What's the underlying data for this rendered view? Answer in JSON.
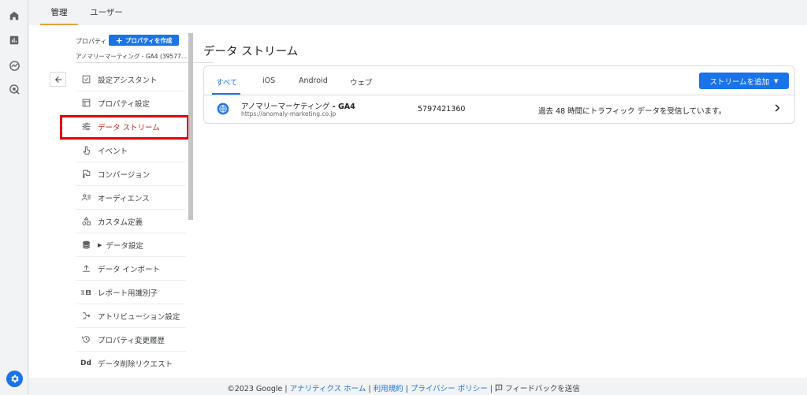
{
  "topbar": {
    "tabs": [
      {
        "label": "管理",
        "active": true
      },
      {
        "label": "ユーザー",
        "active": false
      }
    ]
  },
  "rail": {
    "icons": [
      "home-icon",
      "reports-icon",
      "explore-icon",
      "advertising-icon"
    ],
    "settings_icon": "gear-icon"
  },
  "property": {
    "label": "プロパティ",
    "create_button": "プロパティを作成",
    "name": "アノマリーマーティング - GA4 (39577…"
  },
  "menu": {
    "items": [
      {
        "label": "設定アシスタント",
        "icon": "checklist-icon"
      },
      {
        "label": "プロパティ設定",
        "icon": "property-settings-icon"
      },
      {
        "label": "データ ストリーム",
        "icon": "data-streams-icon"
      },
      {
        "label": "イベント",
        "icon": "touch-icon"
      },
      {
        "label": "コンバージョン",
        "icon": "flag-icon"
      },
      {
        "label": "オーディエンス",
        "icon": "audience-icon"
      },
      {
        "label": "カスタム定義",
        "icon": "shapes-icon"
      },
      {
        "label": "データ設定",
        "icon": "database-icon"
      },
      {
        "label": "データ インポート",
        "icon": "upload-icon"
      },
      {
        "label": "レポート用識別子",
        "icon": "identity-icon"
      },
      {
        "label": "アトリビューション設定",
        "icon": "attribution-icon"
      },
      {
        "label": "プロパティ変更履歴",
        "icon": "history-icon"
      },
      {
        "label": "データ削除リクエスト",
        "icon": "dd-icon",
        "icon_text": "Dd"
      }
    ],
    "active_index": 2,
    "highlight_color": "#e3000b"
  },
  "main": {
    "title": "データ ストリーム",
    "tabs": [
      "すべて",
      "iOS",
      "Android",
      "ウェブ"
    ],
    "active_tab": 0,
    "add_button": "ストリームを追加",
    "streams": [
      {
        "name": "アノマリーマーケティング",
        "suffix": " - GA4",
        "url": "https://anomaly-marketing.co.jp",
        "id": "5797421360",
        "status": "過去 48 時間にトラフィック データを受信しています。"
      }
    ]
  },
  "footer": {
    "copyright": "©2023 Google | ",
    "link_home": "アナリティクス ホーム",
    "sep1": " | ",
    "link_terms": "利用規約",
    "sep2": " | ",
    "link_privacy": "プライバシー ポリシー",
    "sep3": " | ",
    "feedback": " フィードバックを送信"
  },
  "colors": {
    "accent": "#1a73e8",
    "active_tab_underline": "#e8a33d",
    "active_menu": "#c5221f"
  }
}
